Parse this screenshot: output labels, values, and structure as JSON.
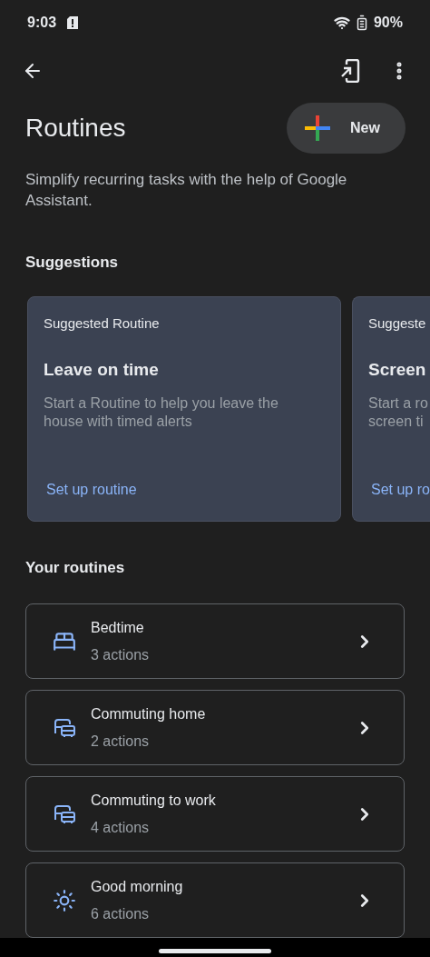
{
  "status_bar": {
    "time": "9:03",
    "battery": "90%"
  },
  "header": {
    "title": "Routines",
    "new_button": "New",
    "description": "Simplify recurring tasks with the help of Google Assistant."
  },
  "suggestions": {
    "heading": "Suggestions",
    "cards": [
      {
        "eyebrow": "Suggested Routine",
        "title": "Leave on time",
        "body": "Start a Routine to help you leave the house with timed alerts",
        "action": "Set up routine"
      },
      {
        "eyebrow": "Suggeste",
        "title": "Screen",
        "body_lines": [
          "Start a ro",
          "screen ti"
        ],
        "action": "Set up ro"
      }
    ]
  },
  "routines": {
    "heading": "Your routines",
    "items": [
      {
        "kind": "bed",
        "name": "Bedtime",
        "actions": "3 actions"
      },
      {
        "kind": "commute",
        "name": "Commuting home",
        "actions": "2 actions"
      },
      {
        "kind": "commute",
        "name": "Commuting to work",
        "actions": "4 actions"
      },
      {
        "kind": "sun",
        "name": "Good morning",
        "actions": "6 actions"
      }
    ]
  }
}
